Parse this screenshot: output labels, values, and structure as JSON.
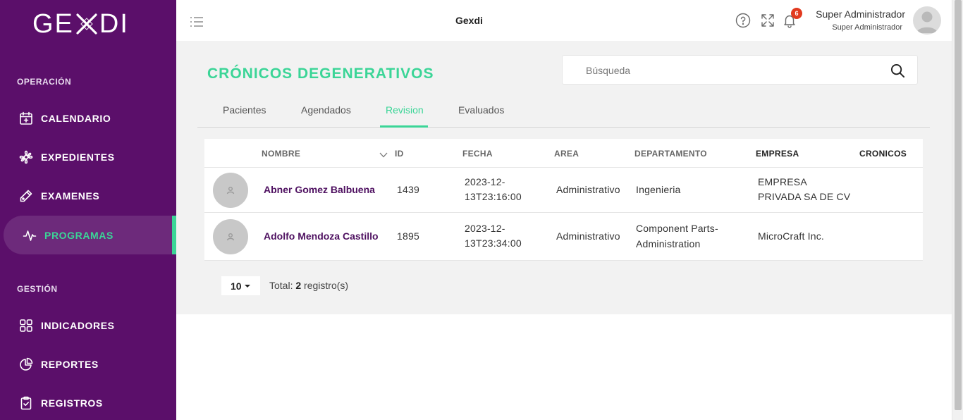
{
  "brand": {
    "logo_text_left": "GE",
    "logo_text_right": "DI",
    "app_title": "Gexdi"
  },
  "colors": {
    "sidebar": "#5b0f6a",
    "accent": "#3bd597",
    "name_link": "#4e1060",
    "badge": "#e23a1f"
  },
  "sidebar": {
    "sections": [
      {
        "title": "OPERACIÓN"
      },
      {
        "title": "GESTIÓN"
      }
    ],
    "items": [
      {
        "label": "CALENDARIO",
        "icon": "calendar-plus-icon"
      },
      {
        "label": "EXPEDIENTES",
        "icon": "flower-icon"
      },
      {
        "label": "EXAMENES",
        "icon": "pen-tool-icon"
      },
      {
        "label": "PROGRAMAS",
        "icon": "activity-icon",
        "active": true
      },
      {
        "label": "INDICADORES",
        "icon": "grid-icon"
      },
      {
        "label": "REPORTES",
        "icon": "pie-chart-icon"
      },
      {
        "label": "REGISTROS",
        "icon": "clipboard-check-icon"
      }
    ]
  },
  "topbar": {
    "icons": [
      "menu-icon",
      "help-icon",
      "fullscreen-icon",
      "bell-icon"
    ],
    "notification_count": "6",
    "user_name": "Super Administrador",
    "user_role": "Super Administrador"
  },
  "page": {
    "title": "CRÓNICOS DEGENERATIVOS",
    "search_placeholder": "Búsqueda",
    "tabs": [
      {
        "label": "Pacientes"
      },
      {
        "label": "Agendados"
      },
      {
        "label": "Revision",
        "active": true
      },
      {
        "label": "Evaluados"
      }
    ]
  },
  "table": {
    "headers": [
      "NOMBRE",
      "ID",
      "FECHA",
      "AREA",
      "DEPARTAMENTO",
      "EMPRESA",
      "CRONICOS"
    ],
    "rows": [
      {
        "name": "Abner Gomez Balbuena",
        "id": "1439",
        "fecha_1": "2023-12-",
        "fecha_2": "13T23:16:00",
        "area": "Administrativo",
        "departamento_1": "Ingenieria",
        "departamento_2": "",
        "empresa_1": "EMPRESA",
        "empresa_2": "PRIVADA SA DE CV",
        "cronicos": ""
      },
      {
        "name": "Adolfo Mendoza Castillo",
        "id": "1895",
        "fecha_1": "2023-12-",
        "fecha_2": "13T23:34:00",
        "area": "Administrativo",
        "departamento_1": "Component Parts-",
        "departamento_2": "Administration",
        "empresa_1": "MicroCraft Inc.",
        "empresa_2": "",
        "cronicos": ""
      }
    ]
  },
  "pagination": {
    "per_page": "10",
    "total_prefix": "Total:",
    "total_count": "2",
    "total_suffix": "registro(s)"
  }
}
